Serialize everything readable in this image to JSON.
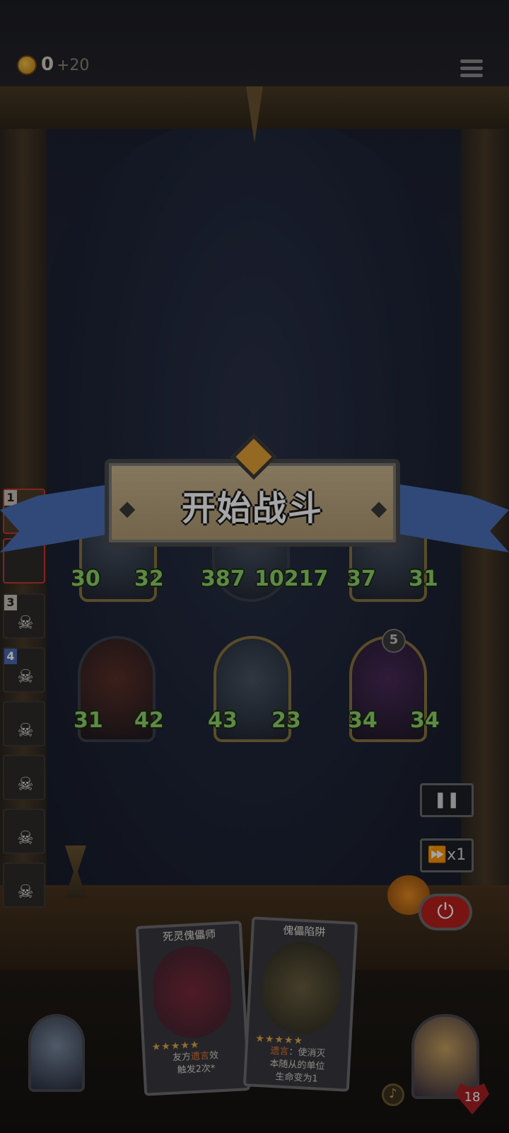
{
  "header": {
    "coins": "0",
    "coin_gain": "+20",
    "coin_icon": "coin-icon",
    "menu_icon": "menu-icon"
  },
  "queue": [
    {
      "number": "1"
    },
    {
      "number": ""
    },
    {
      "number": "3"
    },
    {
      "number": "4"
    },
    {
      "number": ""
    },
    {
      "number": ""
    },
    {
      "number": ""
    },
    {
      "number": ""
    }
  ],
  "board": {
    "enemy_row": [
      {
        "attack": "30",
        "health": "32"
      },
      {
        "attack": "387",
        "health": "10217"
      },
      {
        "attack": "37",
        "health": "31"
      }
    ],
    "ally_row": [
      {
        "attack": "31",
        "health": "42"
      },
      {
        "attack": "43",
        "health": "23"
      },
      {
        "level": "5",
        "attack": "34",
        "health": "34"
      }
    ]
  },
  "banner": {
    "title": "开始战斗"
  },
  "controls": {
    "pause_label": "❚❚",
    "speed_label": "⏩x1",
    "power_label": "⏻"
  },
  "hand": [
    {
      "title": "死灵傀儡师",
      "desc_prefix": "友方",
      "desc_keyword": "遗言",
      "desc_suffix": "效",
      "desc_line2": "触发2次*"
    },
    {
      "title": "傀儡陷阱",
      "desc_keyword": "遗言",
      "desc_suffix": "：使消灭",
      "desc_line2": "本随从的单位",
      "desc_line3": "生命变为1"
    }
  ],
  "hero": {
    "health": "18"
  },
  "colors": {
    "accent_orange": "#e0763a",
    "stat_green": "#8fd36a",
    "ribbon_blue": "#4a70b8",
    "power_red": "#b8201c"
  }
}
